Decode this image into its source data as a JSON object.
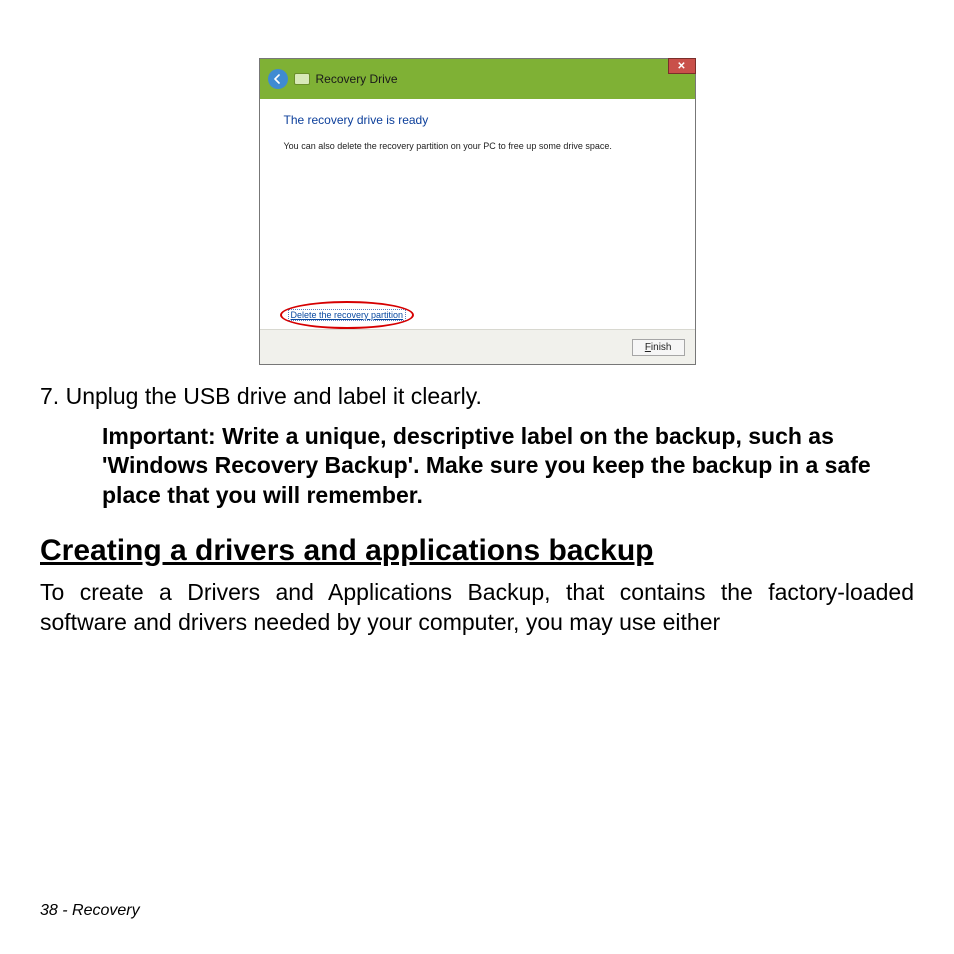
{
  "dialog": {
    "title": "Recovery Drive",
    "heading": "The recovery drive is ready",
    "body_text": "You can also delete the recovery partition on your PC to free up some drive space.",
    "delete_link": "Delete the recovery partition",
    "finish_label": "Finish"
  },
  "step": {
    "number": "7.",
    "text": "Unplug the USB drive and label it clearly."
  },
  "important": "Important: Write a unique, descriptive label on the backup, such as 'Windows Recovery Backup'. Make sure you keep the backup in a safe place that you will remember.",
  "section": {
    "heading": "Creating a drivers and applications backup",
    "text": "To create a Drivers and Applications Backup, that contains the factory-loaded software and drivers needed by your computer, you may use either"
  },
  "footer": {
    "page_number": "38",
    "section_name": "Recovery"
  }
}
